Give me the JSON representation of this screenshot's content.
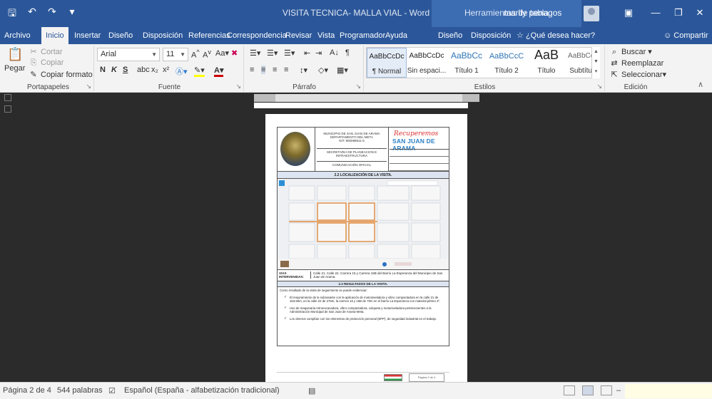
{
  "titlebar": {
    "doc_title": "VISITA TECNICA- MALLA VIAL  -  Word",
    "context_title": "Herramientas de tabla",
    "user": "marlly penagos",
    "qat": [
      "save-icon",
      "undo-icon",
      "redo-icon",
      "customize-icon"
    ]
  },
  "tabs": {
    "archivo": "Archivo",
    "inicio": "Inicio",
    "insertar": "Insertar",
    "diseno": "Diseño",
    "disposicion": "Disposición",
    "referencias": "Referencias",
    "correspondencia": "Correspondencia",
    "revisar": "Revisar",
    "vista": "Vista",
    "programador": "Programador",
    "ayuda": "Ayuda",
    "ctx_diseno": "Diseño",
    "ctx_disposicion": "Disposición",
    "tell_me": "¿Qué desea hacer?",
    "share": "Compartir"
  },
  "ribbon": {
    "clipboard": {
      "label": "Portapapeles",
      "paste": "Pegar",
      "cut": "Cortar",
      "copy": "Copiar",
      "format_painter": "Copiar formato"
    },
    "font": {
      "label": "Fuente",
      "font_name": "Arial",
      "font_size": "11",
      "bold": "N",
      "italic": "K",
      "underline": "S"
    },
    "paragraph": {
      "label": "Párrafo"
    },
    "styles": {
      "label": "Estilos",
      "items": [
        {
          "sample": "AaBbCcDc",
          "name": "¶ Normal"
        },
        {
          "sample": "AaBbCcDc",
          "name": "Sin espaci..."
        },
        {
          "sample": "AaBbCc",
          "name": "Título 1"
        },
        {
          "sample": "AaBbCcC",
          "name": "Título 2"
        },
        {
          "sample": "AaB",
          "name": "Título"
        },
        {
          "sample": "AaBbCcD",
          "name": "Subtítulo"
        }
      ]
    },
    "editing": {
      "label": "Edición",
      "find": "Buscar",
      "replace": "Reemplazar",
      "select": "Seleccionar"
    }
  },
  "document": {
    "header": {
      "municipality": "MUNICIPIO DE SAN JUAN DE ARAMA DEPARTAMENTO DEL META",
      "nit": "NIT: 800098911-5",
      "secretaria": "SECRETARIA DE PLANEACION E INFRAESTRUCTURA",
      "comunicacion": "COMUNICACIÓN OFICIAL",
      "brand_top": "Recuperemos",
      "brand_bottom": "SAN JUAN DE ARAMA"
    },
    "section_location": "2.2    LOCALIZACIÓN DE LA VISITA.",
    "vias_label": "VIAS INTERVENIDAS:",
    "vias_value": "Calle 21, Calle 22, Carrera 16 y Carrera 16B del Barrio La Esperanza del Municipio de San Juan de Arama.",
    "section_results": "2.3 RESULTADOS DE LA VISITA.",
    "results_intro": "Como resultado de la visita de seguimiento se puede evidenciar:",
    "results_items": [
      "El mejoramiento de la subrasante con la aplicación de motoniveladora y vibro compactadora en la calle 21 de 163.50m, en la calle 22 de 275m, la carrera 16 y 16B de 70m en el barrio La Esperanza con material pétreo 3\".",
      "Uso de maquinaria retroexcavadora, vibro compactadora, volqueta y motoniveladora pertenecientes a la Administración Municipal de San Juan de Arama-Meta.",
      "Los obreros cumplían con los elementos de protección personal (EPP), de seguridad industrial en el trabajo."
    ],
    "footer_page": "Página 2 de 4"
  },
  "statusbar": {
    "page": "Página 2 de 4",
    "words": "544 palabras",
    "language": "Español (España - alfabetización tradicional)"
  }
}
